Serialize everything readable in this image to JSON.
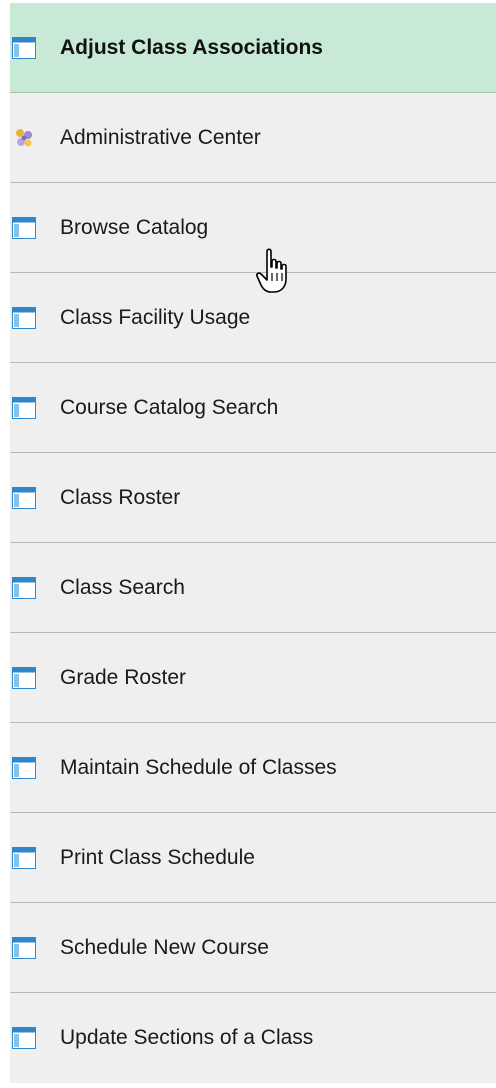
{
  "colors": {
    "item_background": "#efefef",
    "selected_background": "#c7e9d6",
    "divider": "#b9b9b9",
    "text": "#1a1a1a",
    "page_icon_blue": "#2f86c8"
  },
  "menu": {
    "items": [
      {
        "label": "Adjust Class Associations",
        "icon": "component-page-icon",
        "selected": true
      },
      {
        "label": "Administrative Center",
        "icon": "administrative-center-icon",
        "selected": false
      },
      {
        "label": "Browse Catalog",
        "icon": "component-page-icon",
        "selected": false
      },
      {
        "label": "Class Facility Usage",
        "icon": "component-page-icon",
        "selected": false
      },
      {
        "label": "Course Catalog Search",
        "icon": "component-page-icon",
        "selected": false
      },
      {
        "label": "Class Roster",
        "icon": "component-page-icon",
        "selected": false
      },
      {
        "label": "Class Search",
        "icon": "component-page-icon",
        "selected": false
      },
      {
        "label": "Grade Roster",
        "icon": "component-page-icon",
        "selected": false
      },
      {
        "label": "Maintain Schedule of Classes",
        "icon": "component-page-icon",
        "selected": false
      },
      {
        "label": "Print Class Schedule",
        "icon": "component-page-icon",
        "selected": false
      },
      {
        "label": "Schedule New Course",
        "icon": "component-page-icon",
        "selected": false
      },
      {
        "label": "Update Sections of a Class",
        "icon": "component-page-icon",
        "selected": false
      }
    ]
  },
  "cursor": {
    "icon": "hand-pointer-cursor-icon"
  }
}
